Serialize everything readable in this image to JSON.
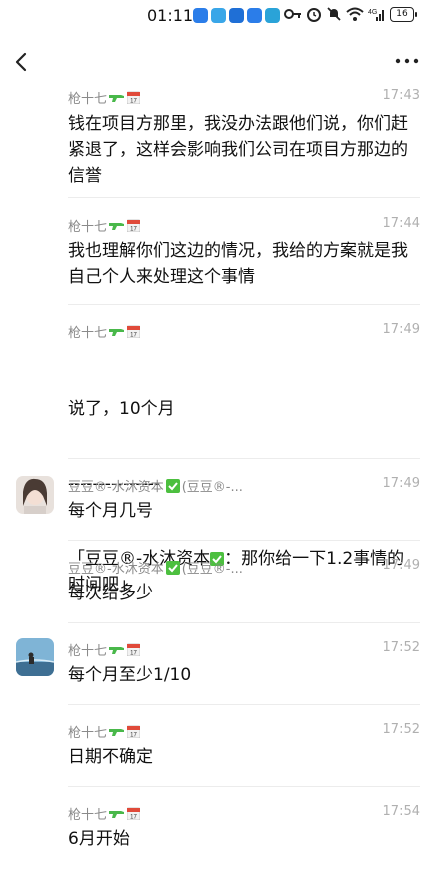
{
  "status_bar": {
    "time": "01:11",
    "battery": "16",
    "signal": "4G"
  },
  "header": {
    "back_label": "back",
    "more_label": "more"
  },
  "messages": [
    {
      "sender": "枪十七",
      "time": "17:43",
      "text": "钱在项目方那里，我没办法跟他们说，你们赶紧退了，这样会影响我们公司在项目方那边的信誉"
    },
    {
      "sender": "枪十七",
      "time": "17:44",
      "text": "我也理解你们这边的情况，我给的方案就是我自己个人来处理这个事情"
    },
    {
      "sender": "枪十七",
      "time": "17:49",
      "text": "说了，10个月",
      "separator": "---------------",
      "quote_open": "「豆豆®-水沐资本",
      "quote_close": "：那你给一下1.2事情的时间吧」"
    },
    {
      "sender": "豆豆®-水沐资本",
      "sender_suffix": "(豆豆®-...",
      "time": "17:49",
      "text": "每个月几号"
    },
    {
      "sender": "豆豆®-水沐资本",
      "sender_suffix": "(豆豆®-...",
      "time": "17:49",
      "text": "每次给多少"
    },
    {
      "sender": "枪十七",
      "time": "17:52",
      "text": "每个月至少1/10"
    },
    {
      "sender": "枪十七",
      "time": "17:52",
      "text": "日期不确定"
    },
    {
      "sender": "枪十七",
      "time": "17:54",
      "text": "6月开始"
    }
  ],
  "colors": {
    "sender": "#8a8a8a",
    "time": "#b0b0b0",
    "check_emoji": "#4cbf3f",
    "calendar_emoji": "#e04a3a",
    "gun_emoji": "#49b84a"
  },
  "icons": [
    "back-arrow-icon",
    "more-dots-icon",
    "water-gun-emoji",
    "calendar-emoji",
    "check-mark-emoji"
  ]
}
